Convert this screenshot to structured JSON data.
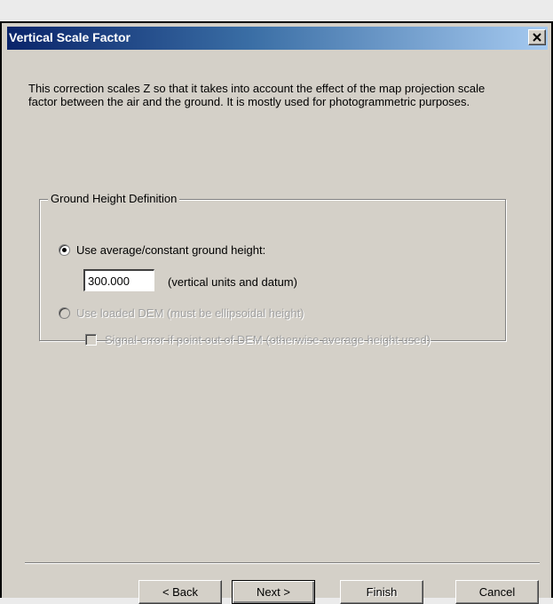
{
  "window": {
    "title": "Vertical Scale Factor",
    "close_icon": "close-x-icon"
  },
  "description": "This correction scales Z so that it takes into account the effect of the map projection scale factor between the air and the ground.  It is mostly used for photogrammetric purposes.",
  "ground_height": {
    "legend": "Ground Height Definition",
    "option_average_label": "Use average/constant ground height:",
    "option_average_selected": true,
    "height_value": "300.000",
    "height_units_label": "(vertical units and datum)",
    "option_dem_label": "Use loaded DEM (must be ellipsoidal height)",
    "option_dem_enabled": false,
    "signal_error_label": "Signal error if point out of DEM (otherwise average height used)",
    "signal_error_checked": false,
    "signal_error_enabled": false
  },
  "buttons": {
    "back": "< Back",
    "next": "Next >",
    "finish": "Finish",
    "cancel": "Cancel",
    "finish_enabled": false
  }
}
